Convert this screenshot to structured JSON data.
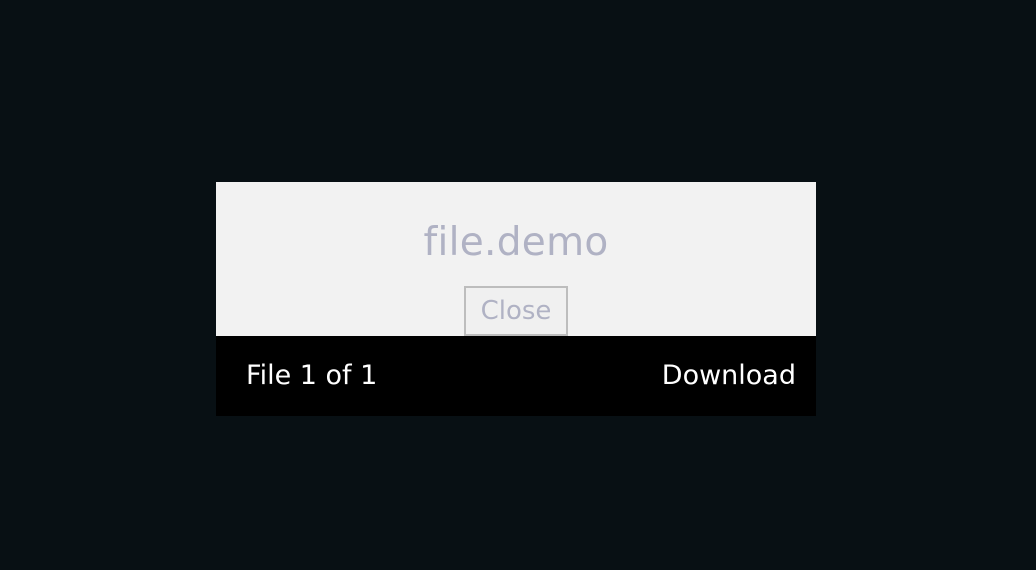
{
  "viewer": {
    "file_name": "file.demo",
    "close_label": "Close",
    "counter_text": "File 1 of 1",
    "download_label": "Download"
  },
  "colors": {
    "backdrop": "#081014",
    "preview_background": "#f2f2f2",
    "footer_background": "#000000",
    "muted_text": "#b0b2c4",
    "footer_text": "#ffffff"
  }
}
